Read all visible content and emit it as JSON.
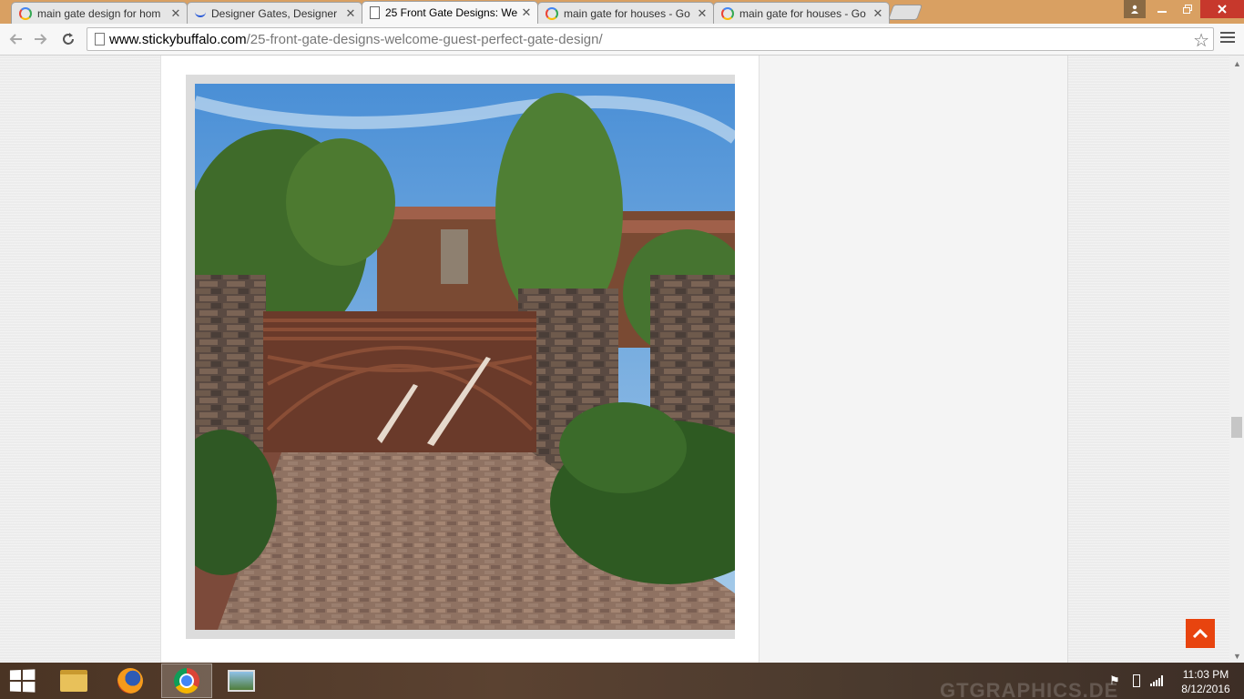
{
  "browser": {
    "tabs": [
      {
        "title": "main gate design for hom",
        "icon": "google-icon",
        "active": false
      },
      {
        "title": "Designer Gates, Designer",
        "icon": "designer-gates-icon",
        "active": false
      },
      {
        "title": "25 Front Gate Designs: We",
        "icon": "page-icon",
        "active": true
      },
      {
        "title": "main gate for houses - Go",
        "icon": "google-icon",
        "active": false
      },
      {
        "title": "main gate for houses - Go",
        "icon": "google-icon",
        "active": false
      }
    ],
    "close_glyph": "✕",
    "url_host": "www.stickybuffalo.com",
    "url_path": "/25-front-gate-designs-welcome-guest-perfect-gate-design/"
  },
  "page": {
    "image_subject": "copper-gate-driveway-photo",
    "accent_color": "#e8440f"
  },
  "taskbar": {
    "apps": [
      "file-explorer",
      "firefox",
      "chrome",
      "photos"
    ],
    "active_app": "chrome",
    "watermark": "GTGRAPHICS.DE",
    "time": "11:03 PM",
    "date": "8/12/2016"
  }
}
